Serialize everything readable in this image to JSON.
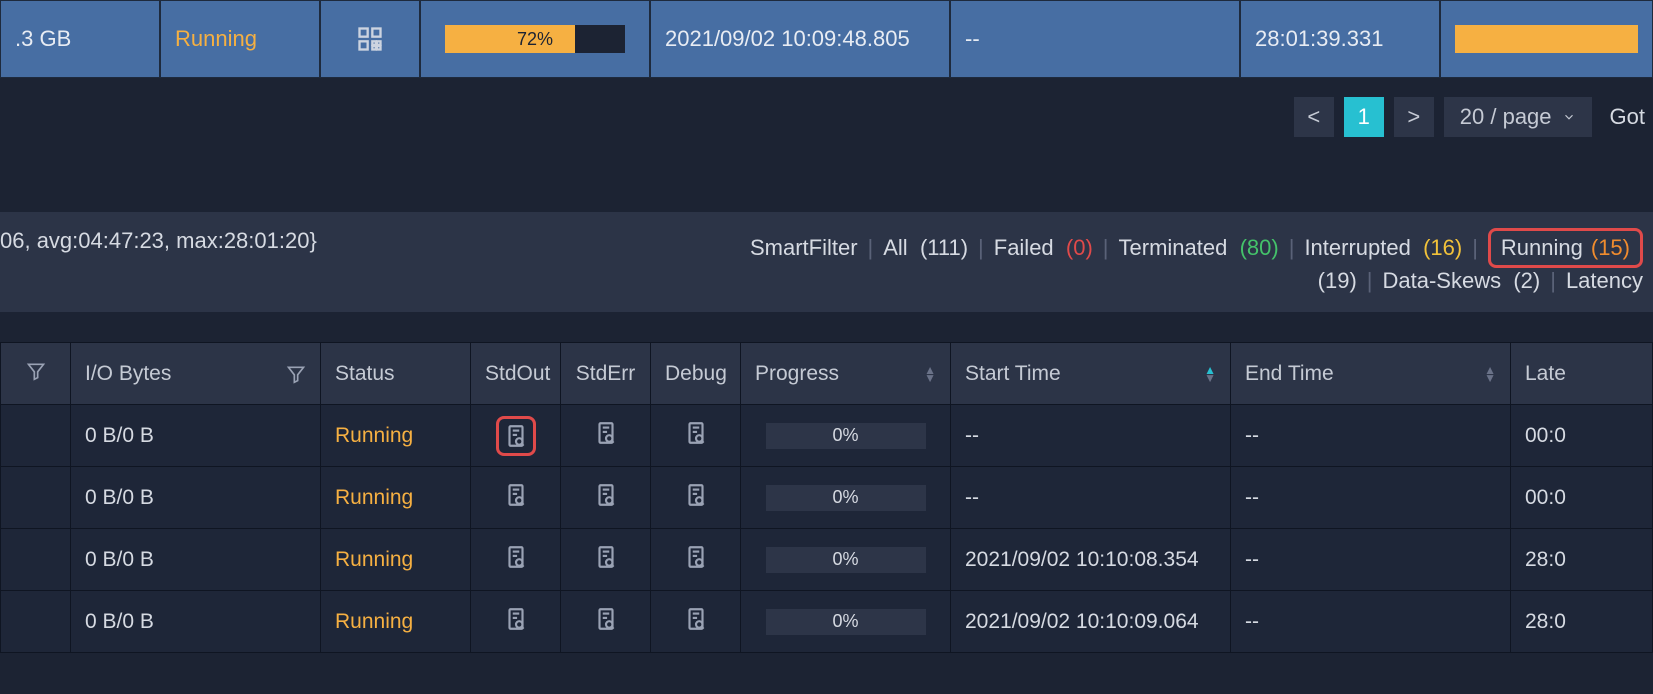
{
  "top_row": {
    "size": ".3 GB",
    "status": "Running",
    "progress_pct": "72%",
    "progress_fill": 72,
    "start_time": "2021/09/02 10:09:48.805",
    "end_time": "--",
    "duration": "28:01:39.331"
  },
  "pagination": {
    "prev": "<",
    "current": "1",
    "next": ">",
    "page_size": "20 / page",
    "goto": "Got"
  },
  "stats_text": "06, avg:04:47:23, max:28:01:20}",
  "filters": {
    "smartfilter": "SmartFilter",
    "all_label": "All",
    "all_count": "(111)",
    "failed_label": "Failed",
    "failed_count": "(0)",
    "term_label": "Terminated",
    "term_count": "(80)",
    "int_label": "Interrupted",
    "int_count": "(16)",
    "run_label": "Running",
    "run_count": "(15)",
    "extra_count": "(19)",
    "skew_label": "Data-Skews",
    "skew_count": "(2)",
    "latency_label": "Latency"
  },
  "headers": {
    "io": "I/O Bytes",
    "status": "Status",
    "stdout": "StdOut",
    "stderr": "StdErr",
    "debug": "Debug",
    "progress": "Progress",
    "start": "Start Time",
    "end": "End Time",
    "latency": "Late"
  },
  "rows": [
    {
      "io": "0 B/0 B",
      "status": "Running",
      "progress": "0%",
      "start": "--",
      "end": "--",
      "lat": "00:0"
    },
    {
      "io": "0 B/0 B",
      "status": "Running",
      "progress": "0%",
      "start": "--",
      "end": "--",
      "lat": "00:0"
    },
    {
      "io": "0 B/0 B",
      "status": "Running",
      "progress": "0%",
      "start": "2021/09/02 10:10:08.354",
      "end": "--",
      "lat": "28:0"
    },
    {
      "io": "0 B/0 B",
      "status": "Running",
      "progress": "0%",
      "start": "2021/09/02 10:10:09.064",
      "end": "--",
      "lat": "28:0"
    }
  ]
}
